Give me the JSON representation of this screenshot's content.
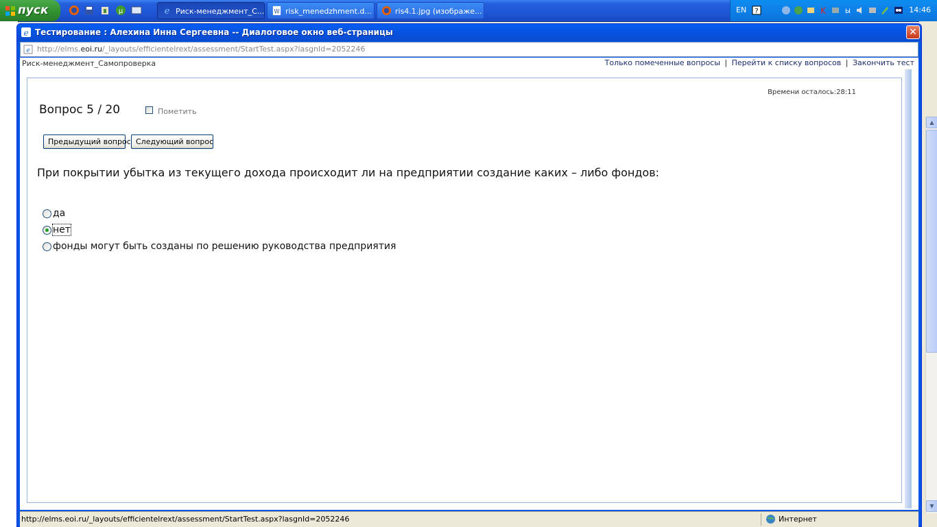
{
  "taskbar": {
    "start_label": "пуск",
    "tasks": [
      {
        "label": "Риск-менеджмент_С...",
        "icon": "ie-icon",
        "active": true
      },
      {
        "label": "risk_menedzhment.d...",
        "icon": "word-document-icon",
        "active": false
      },
      {
        "label": "ris4.1.jpg (изображе...",
        "icon": "firefox-icon",
        "active": false
      }
    ],
    "quick_launch": [
      "firefox-icon",
      "save-icon",
      "tree-icon",
      "utorrent-icon",
      "desktop-icon"
    ],
    "tray": {
      "language": "EN",
      "icons": [
        "help-icon",
        "network-icon",
        "sync-icon",
        "antivirus-icon",
        "monitor-icon",
        "bluetooth-icon",
        "volume-icon",
        "display-icon",
        "pen-icon",
        "messenger-icon"
      ],
      "clock": "14:46"
    }
  },
  "dialog": {
    "title": "Тестирование : Алехина Инна Сергеевна -- Диалоговое окно веб-страницы",
    "address": {
      "prefix": "http://elms.",
      "domain": "eoi.ru",
      "suffix": "/_layouts/efficientelrext/assessment/StartTest.aspx?lasgnId=2052246"
    },
    "course_title": "Риск-менеджмент_Самопроверка",
    "top_links": [
      "Только помеченные вопросы",
      "Перейти к списку вопросов",
      "Закончить тест"
    ],
    "top_links_separator": "|",
    "timer": "Времени осталось:28:11",
    "question_counter": "Вопрос 5 / 20",
    "mark_label": "Пометить",
    "mark_checked": false,
    "prev_button": "Предыдущий вопрос",
    "next_button": "Следующий вопрос",
    "question_text": "При покрытии убытка из текущего дохода происходит ли на предприятии создание каких – либо фондов:",
    "answers": [
      {
        "label": "да",
        "checked": false
      },
      {
        "label": "нет",
        "checked": true
      },
      {
        "label": "фонды могут быть созданы по решению руководства предприятия",
        "checked": false
      }
    ],
    "status_url": "http://elms.eoi.ru/_layouts/efficientelrext/assessment/StartTest.aspx?lasgnId=2052246",
    "zone_label": "Интернет"
  },
  "colors": {
    "xp_blue": "#0054e3",
    "start_green": "#2f8f2f",
    "radio_dot": "#21a121"
  }
}
